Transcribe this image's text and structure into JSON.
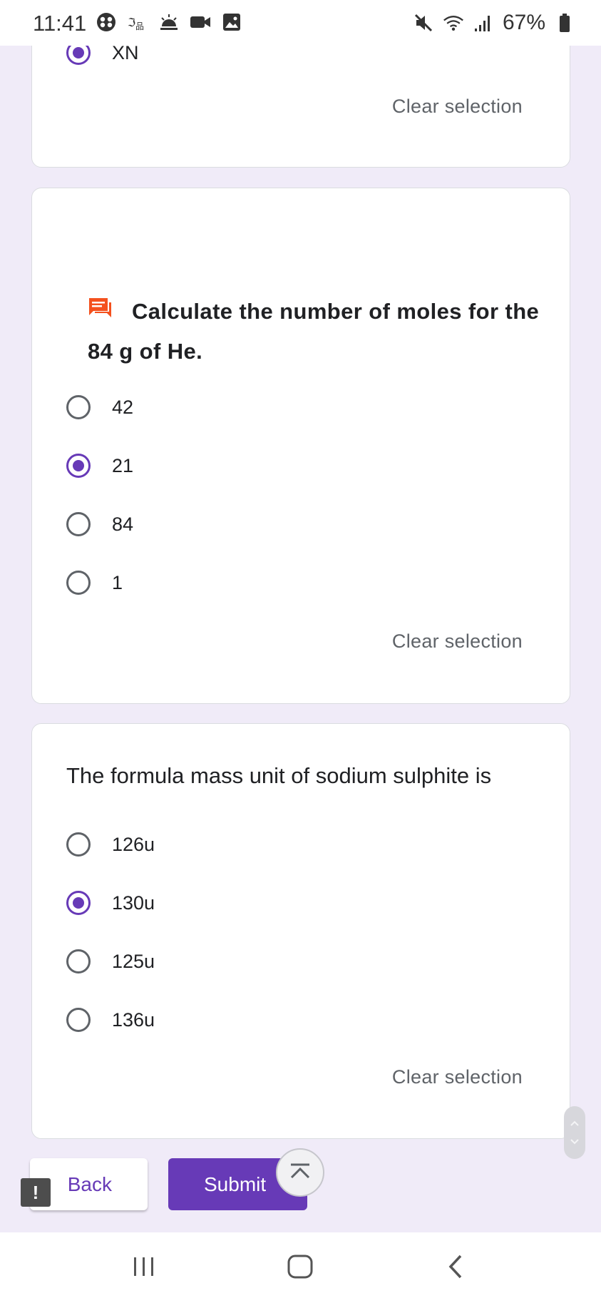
{
  "status_bar": {
    "time": "11:41",
    "battery": "67%",
    "left_icons": [
      "palette-icon",
      "translate-icon",
      "weather-icon",
      "video-icon",
      "image-icon"
    ],
    "right_icons": [
      "mute-icon",
      "wifi-icon",
      "signal-icon",
      "battery-icon"
    ]
  },
  "prev_card": {
    "partial_option": "XN",
    "clear_label": "Clear selection"
  },
  "question1": {
    "title": "Calculate the number of moles for the 84 g of He.",
    "icon": "feedback-chat-icon",
    "options": [
      "42",
      "21",
      "84",
      "1"
    ],
    "selected": "21",
    "clear_label": "Clear selection"
  },
  "question2": {
    "title": "The formula mass unit of sodium sulphite is",
    "options": [
      "126u",
      "130u",
      "125u",
      "136u"
    ],
    "selected": "130u",
    "clear_label": "Clear selection"
  },
  "footer": {
    "back_label": "Back",
    "submit_label": "Submit"
  },
  "colors": {
    "accent": "#673ab7",
    "page_bg": "#f0ebf8",
    "question_icon": "#f4511e"
  }
}
